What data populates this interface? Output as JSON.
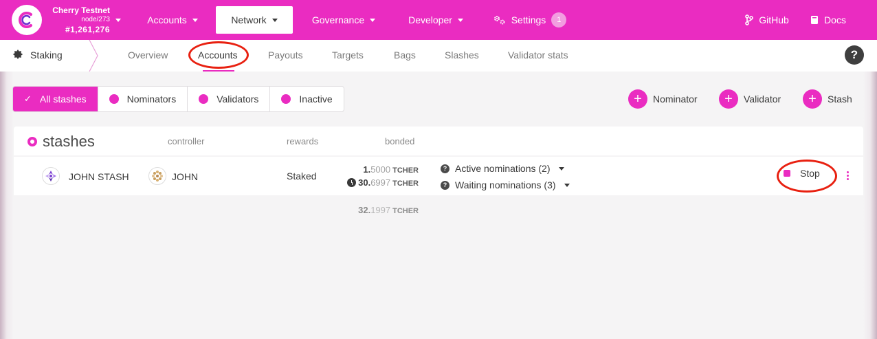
{
  "header": {
    "chain_name": "Cherry Testnet",
    "node": "node/273",
    "block": "#1,261,276",
    "nav": [
      {
        "label": "Accounts"
      },
      {
        "label": "Network"
      },
      {
        "label": "Governance"
      },
      {
        "label": "Developer"
      },
      {
        "label": "Settings",
        "badge": "1"
      }
    ],
    "github": "GitHub",
    "docs": "Docs"
  },
  "subnav": {
    "section": "Staking",
    "tabs": [
      "Overview",
      "Accounts",
      "Payouts",
      "Targets",
      "Bags",
      "Slashes",
      "Validator stats"
    ],
    "active_tab": "Accounts",
    "help": "?"
  },
  "filters": {
    "items": [
      "All stashes",
      "Nominators",
      "Validators",
      "Inactive"
    ],
    "selected": "All stashes"
  },
  "actions": [
    "Nominator",
    "Validator",
    "Stash"
  ],
  "table": {
    "title": "stashes",
    "columns": [
      "controller",
      "rewards",
      "bonded"
    ],
    "rows": [
      {
        "stash": "JOHN STASH",
        "controller": "JOHN",
        "rewards": "Staked",
        "bonded": {
          "int": "1.",
          "dec": "5000",
          "unit": "TCHER"
        },
        "unbonding": {
          "int": "30.",
          "dec": "6997",
          "unit": "TCHER"
        },
        "active_nominations": "Active nominations (2)",
        "waiting_nominations": "Waiting nominations (3)",
        "action": "Stop"
      }
    ],
    "total": {
      "int": "32.",
      "dec": "1997",
      "unit": "TCHER"
    }
  },
  "colors": {
    "accent": "#ea2cc1",
    "annotation": "#e82010"
  }
}
